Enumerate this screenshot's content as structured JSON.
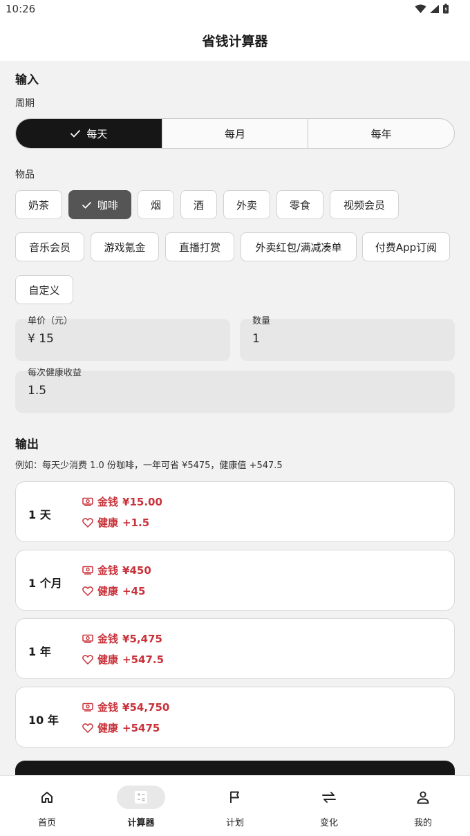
{
  "status_bar": {
    "time": "10:26"
  },
  "app_bar": {
    "title": "省钱计算器"
  },
  "input": {
    "section_title": "输入",
    "period_label": "周期",
    "periods": [
      "每天",
      "每月",
      "每年"
    ],
    "items_label": "物品",
    "items": [
      "奶茶",
      "咖啡",
      "烟",
      "酒",
      "外卖",
      "零食",
      "视频会员",
      "音乐会员",
      "游戏氪金",
      "直播打赏",
      "外卖红包/满减凑单",
      "付费App订阅",
      "自定义"
    ],
    "price_label": "单价（元）",
    "price_value": "¥ 15",
    "quantity_label": "数量",
    "quantity_value": "1",
    "health_label": "每次健康收益",
    "health_value": "1.5"
  },
  "output": {
    "section_title": "输出",
    "example": "例如：每天少消费 1.0 份咖啡，一年可省 ¥5475，健康值 +547.5",
    "money_label": "金钱",
    "health_label": "健康",
    "results": [
      {
        "period": "1 天",
        "money": "¥15.00",
        "health": "+1.5"
      },
      {
        "period": "1 个月",
        "money": "¥450",
        "health": "+45"
      },
      {
        "period": "1 年",
        "money": "¥5,475",
        "health": "+547.5"
      },
      {
        "period": "10 年",
        "money": "¥54,750",
        "health": "+5475"
      }
    ]
  },
  "nav": {
    "items": [
      {
        "label": "首页",
        "icon": "home-icon"
      },
      {
        "label": "计算器",
        "icon": "calculator-icon"
      },
      {
        "label": "计划",
        "icon": "flag-icon"
      },
      {
        "label": "变化",
        "icon": "swap-icon"
      },
      {
        "label": "我的",
        "icon": "person-icon"
      }
    ]
  },
  "colors": {
    "accent": "#c8323a",
    "dark": "#161616",
    "chip_active": "#555555"
  }
}
